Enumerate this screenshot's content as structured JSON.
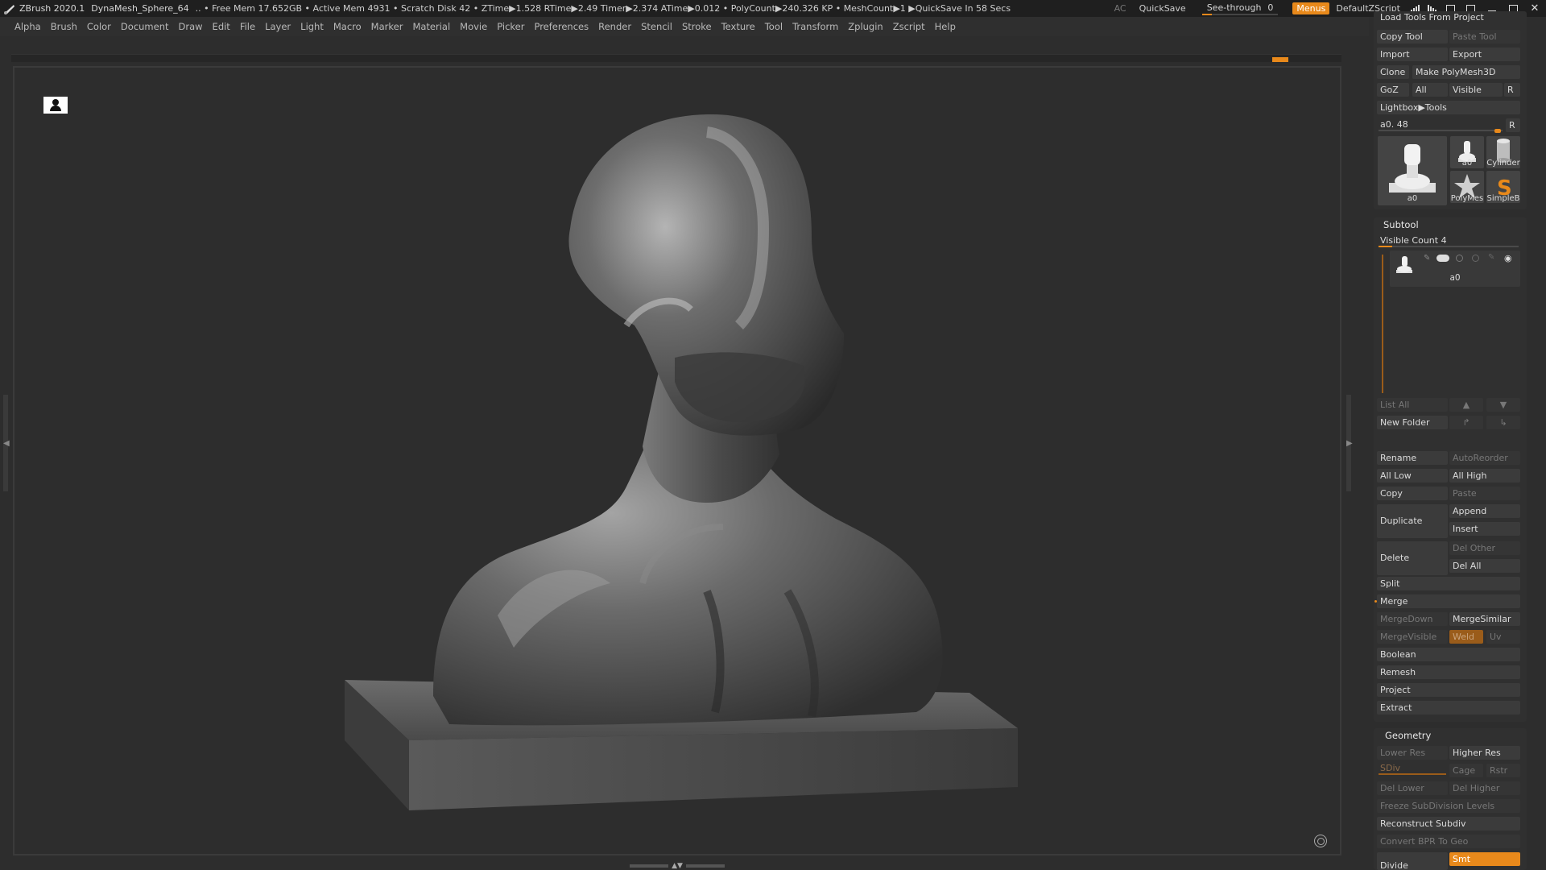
{
  "titlebar": {
    "app": "ZBrush 2020.1",
    "document": "DynaMesh_Sphere_64",
    "stats": ".. • Free Mem 17.652GB • Active Mem 4931 • Scratch Disk 42 •  ZTime▶1.528 RTime▶2.49 Timer▶2.374 ATime▶0.012 • PolyCount▶240.326 KP  • MeshCount▶1  ▶QuickSave In 58 Secs",
    "ac": "AC",
    "quicksave": "QuickSave",
    "see_through_label": "See-through",
    "see_through_value": "0",
    "menus": "Menus",
    "script": "DefaultZScript"
  },
  "menu_items": [
    "Alpha",
    "Brush",
    "Color",
    "Document",
    "Draw",
    "Edit",
    "File",
    "Layer",
    "Light",
    "Macro",
    "Marker",
    "Material",
    "Movie",
    "Picker",
    "Preferences",
    "Render",
    "Stencil",
    "Stroke",
    "Texture",
    "Tool",
    "Transform",
    "Zplugin",
    "Zscript",
    "Help"
  ],
  "tool_panel": {
    "load_tools": "Load Tools From Project",
    "copy_tool": "Copy Tool",
    "paste_tool": "Paste Tool",
    "import": "Import",
    "export": "Export",
    "clone": "Clone",
    "make_polymesh": "Make PolyMesh3D",
    "goz": "GoZ",
    "all": "All",
    "visible": "Visible",
    "r": "R",
    "lightbox": "Lightbox▶Tools",
    "current_tool_slider": "a0. 48",
    "thumbs": [
      "a0",
      "a0",
      "Cylinder",
      "PolyMes",
      "SimpleB"
    ]
  },
  "subtool": {
    "title": "Subtool",
    "visible_count": "Visible Count 4",
    "visible_count_level": 0.1,
    "item_name": "a0",
    "list_all": "List All",
    "new_folder": "New Folder",
    "rename": "Rename",
    "auto_reorder": "AutoReorder",
    "all_low": "All Low",
    "all_high": "All High",
    "copy": "Copy",
    "paste": "Paste",
    "duplicate": "Duplicate",
    "append": "Append",
    "insert": "Insert",
    "delete": "Delete",
    "del_other": "Del Other",
    "del_all": "Del All",
    "split": "Split",
    "merge": "Merge",
    "merge_down": "MergeDown",
    "merge_similar": "MergeSimilar",
    "merge_visible": "MergeVisible",
    "weld": "Weld",
    "uv": "Uv",
    "boolean": "Boolean",
    "remesh": "Remesh",
    "project": "Project",
    "extract": "Extract"
  },
  "geometry": {
    "title": "Geometry",
    "lower_res": "Lower Res",
    "higher_res": "Higher Res",
    "sdiv": "SDiv",
    "cage": "Cage",
    "rstr": "Rstr",
    "del_lower": "Del Lower",
    "del_higher": "Del Higher",
    "freeze": "Freeze SubDivision Levels",
    "reconstruct": "Reconstruct Subdiv",
    "convert_bpr": "Convert BPR To Geo",
    "divide": "Divide",
    "smt": "Smt"
  },
  "colors": {
    "accent": "#e8891b",
    "panel": "#303030",
    "button": "#3b3b3b",
    "canvas": "#2d2d2d"
  }
}
